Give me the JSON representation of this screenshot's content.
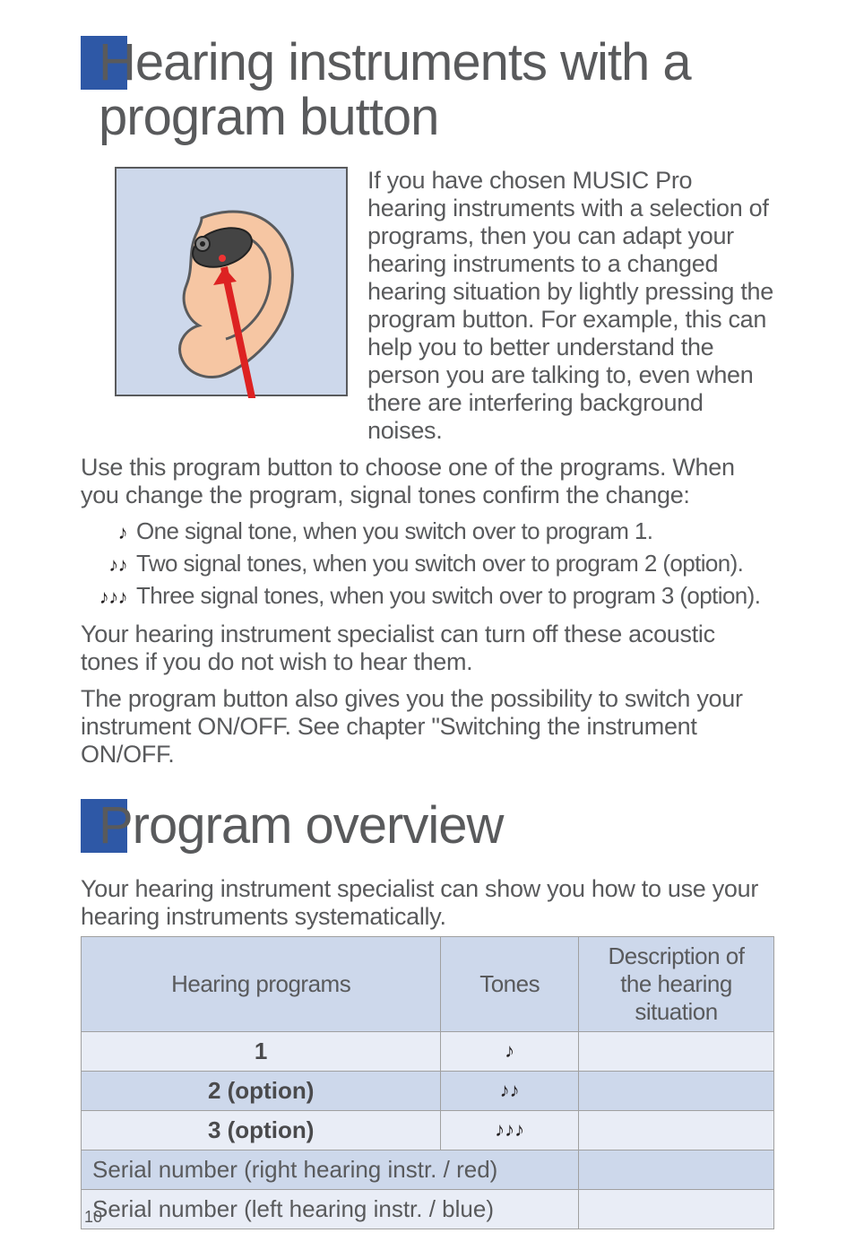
{
  "section1": {
    "title": "Hearing instruments with a program button",
    "intro": "If you have chosen MUSIC Pro hearing instruments with a selection of programs, then you can adapt your hearing instruments to a changed hearing situation by lightly pressing the program button. For example, this can help you to better understand the person you are talking to, even when there are interfering background noises.",
    "para1": "Use this program button to choose one of the programs. When you change the program, signal tones confirm the change:",
    "tones": [
      {
        "icon": "♪",
        "text": "One signal tone, when you switch over to program 1."
      },
      {
        "icon": "♪♪",
        "text": "Two signal tones, when you switch over to program 2 (option)."
      },
      {
        "icon": "♪♪♪",
        "text": "Three signal tones, when you switch over to program 3 (option)."
      }
    ],
    "para2": "Your hearing instrument specialist can turn off these acoustic tones if you do not wish to hear them.",
    "para3": "The program button also gives you the possibility to switch your instrument ON/OFF. See chapter \"Switching the instrument ON/OFF."
  },
  "section2": {
    "title": "Program overview",
    "intro": "Your hearing instrument specialist can show you how to use your hearing instruments systematically.",
    "table": {
      "headers": {
        "col1": "Hearing programs",
        "col2": "Tones",
        "col3": "Description of the hearing situation"
      },
      "rows": [
        {
          "program": "1",
          "tones": "♪",
          "desc": ""
        },
        {
          "program": "2 (option)",
          "tones": "♪♪",
          "desc": ""
        },
        {
          "program": "3 (option)",
          "tones": "♪♪♪",
          "desc": ""
        }
      ],
      "serial_right": "Serial number (right hearing instr. / red)",
      "serial_left": "Serial number (left hearing instr. / blue)"
    }
  },
  "page_number": "10"
}
